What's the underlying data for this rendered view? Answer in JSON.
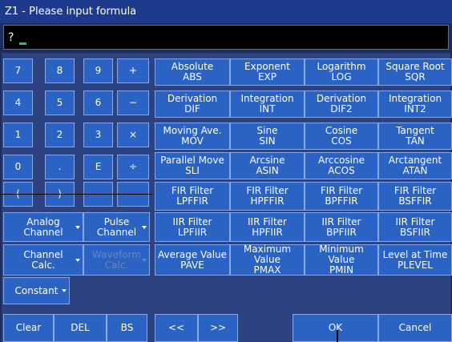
{
  "title": "Z1 - Please input formula",
  "formula": {
    "prompt": "?"
  },
  "keypad": {
    "row1": [
      "7",
      "8",
      "9",
      "+"
    ],
    "row2": [
      "4",
      "5",
      "6",
      "−"
    ],
    "row3": [
      "1",
      "2",
      "3",
      "×"
    ],
    "row4": [
      "0",
      ".",
      "E",
      "÷"
    ],
    "row5": [
      "(",
      ")",
      "",
      ""
    ]
  },
  "channel_buttons": {
    "analog": [
      "Analog",
      "Channel"
    ],
    "pulse": [
      "Pulse",
      "Channel"
    ],
    "channel_calc": [
      "Channel",
      "Calc."
    ],
    "waveform_calc": [
      "Waveform",
      "Calc."
    ],
    "constant": "Constant"
  },
  "functions": [
    [
      {
        "name": "Absolute",
        "code": "ABS"
      },
      {
        "name": "Exponent",
        "code": "EXP"
      },
      {
        "name": "Logarithm",
        "code": "LOG"
      },
      {
        "name": "Square Root",
        "code": "SQR"
      }
    ],
    [
      {
        "name": "Derivation",
        "code": "DIF"
      },
      {
        "name": "Integration",
        "code": "INT"
      },
      {
        "name": "Derivation",
        "code": "DIF2"
      },
      {
        "name": "Integration",
        "code": "INT2"
      }
    ],
    [
      {
        "name": "Moving Ave.",
        "code": "MOV"
      },
      {
        "name": "Sine",
        "code": "SIN"
      },
      {
        "name": "Cosine",
        "code": "COS"
      },
      {
        "name": "Tangent",
        "code": "TAN"
      }
    ],
    [
      {
        "name": "Parallel Move",
        "code": "SLI"
      },
      {
        "name": "Arcsine",
        "code": "ASIN"
      },
      {
        "name": "Arccosine",
        "code": "ACOS"
      },
      {
        "name": "Arctangent",
        "code": "ATAN"
      }
    ],
    [
      {
        "name": "FIR Filter",
        "code": "LPFFIR"
      },
      {
        "name": "FIR Filter",
        "code": "HPFFIR"
      },
      {
        "name": "FIR Filter",
        "code": "BPFFIR"
      },
      {
        "name": "FIR Filter",
        "code": "BSFFIR"
      }
    ],
    [
      {
        "name": "IIR Filter",
        "code": "LPFIIR"
      },
      {
        "name": "IIR Filter",
        "code": "HPFIIR"
      },
      {
        "name": "IIR Filter",
        "code": "BPFIIR"
      },
      {
        "name": "IIR Filter",
        "code": "BSFIIR"
      }
    ],
    [
      {
        "name": "Average Value",
        "code": "PAVE"
      },
      {
        "name": "Maximum Value",
        "code": "PMAX"
      },
      {
        "name": "Minimum Value",
        "code": "PMIN"
      },
      {
        "name": "Level at Time",
        "code": "PLEVEL"
      }
    ]
  ],
  "bottom": {
    "clear": "Clear",
    "del": "DEL",
    "bs": "BS",
    "left": "<<",
    "right": ">>",
    "ok": "OK",
    "cancel": "Cancel"
  }
}
